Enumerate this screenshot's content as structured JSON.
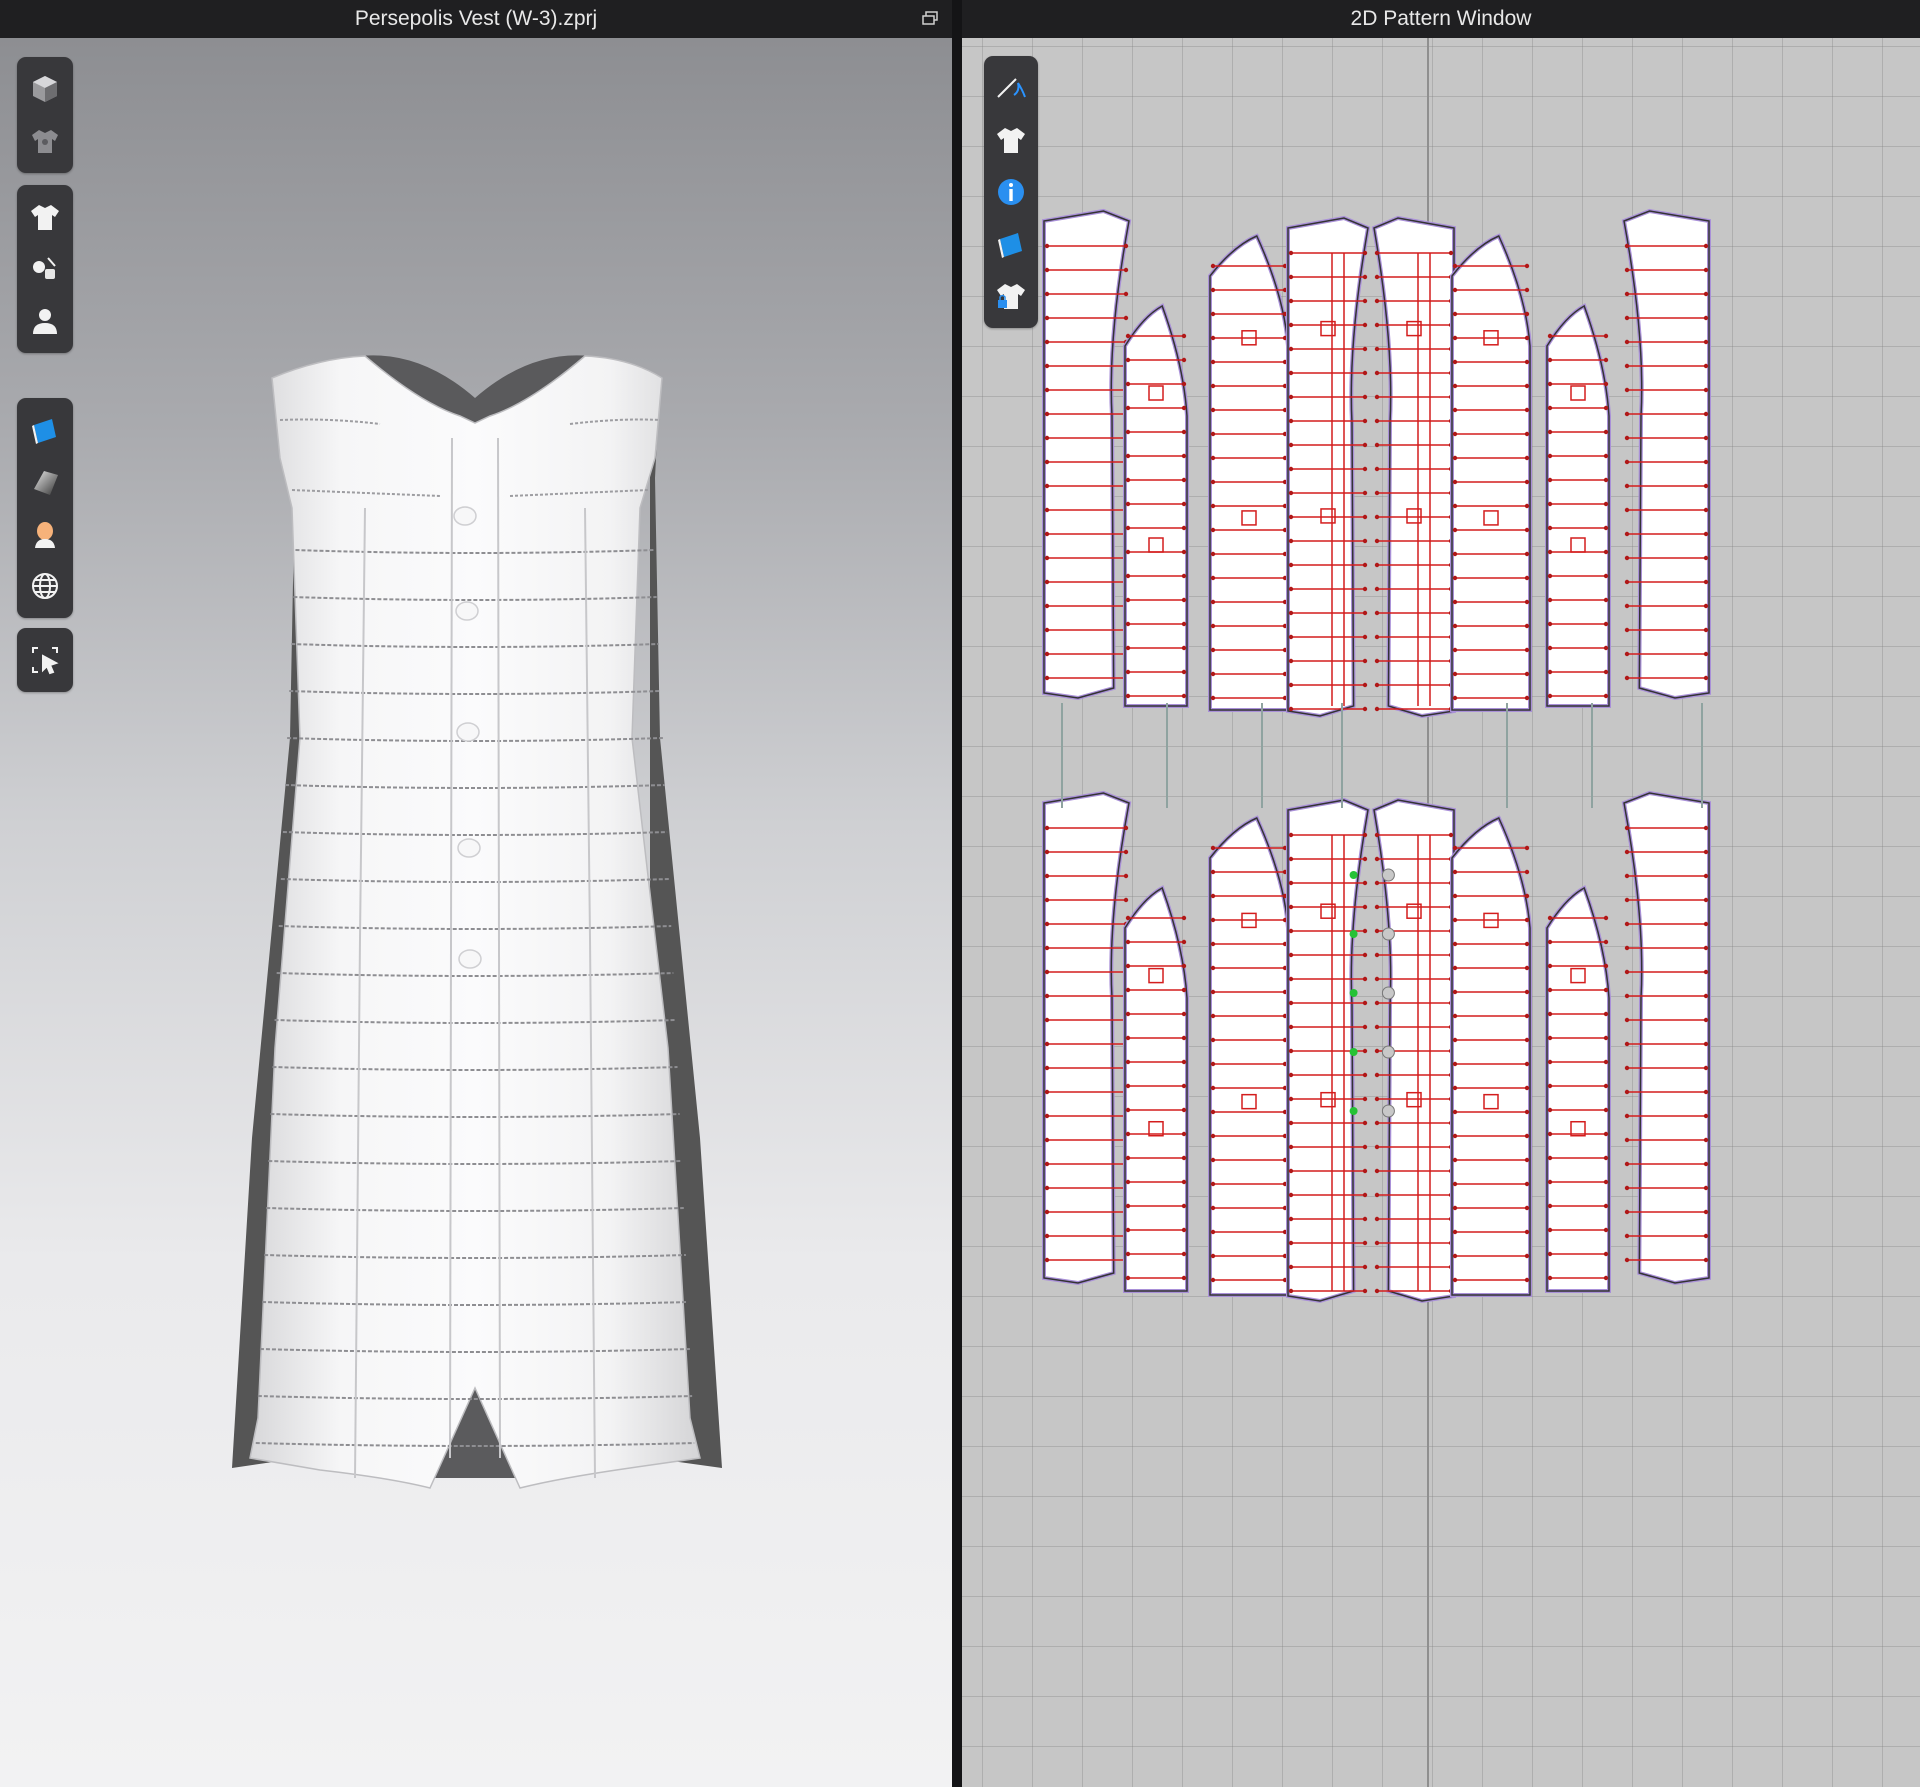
{
  "windows": {
    "left_title": "Persepolis Vest (W-3).zprj",
    "right_title": "2D Pattern Window"
  },
  "toolbar_3d": {
    "groups": [
      [
        "cube-icon",
        "garment-thumbnail-icon"
      ],
      [
        "shirt-icon",
        "button-tool-icon",
        "avatar-icon"
      ],
      [
        "fabric-swatch-icon",
        "shading-icon",
        "skin-icon",
        "globe-icon"
      ],
      [
        "select-transform-icon"
      ]
    ]
  },
  "toolbar_2d": {
    "items": [
      "edit-curve-icon",
      "garment-icon",
      "info-icon",
      "fabric-swatch-icon",
      "lock-garment-icon"
    ]
  },
  "colors": {
    "seam_red": "#d41d1d",
    "outline_lilac": "#a990d8",
    "pattern_fill": "#ffffff",
    "grid_bg": "#c6c6c6",
    "button_green": "#25c236"
  }
}
